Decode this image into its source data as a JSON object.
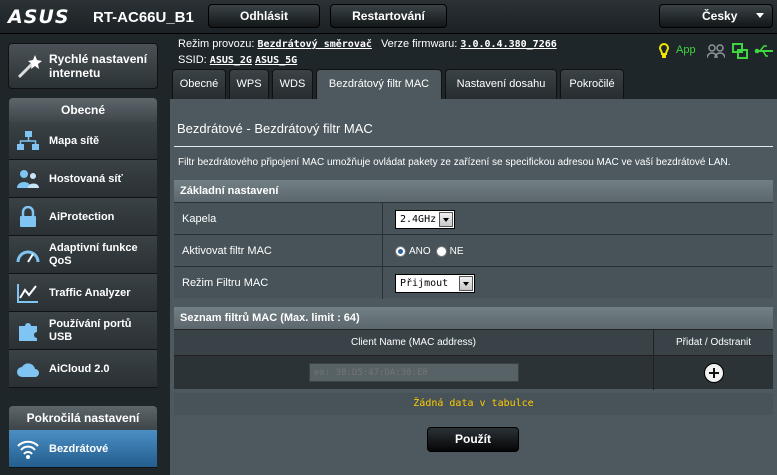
{
  "header": {
    "brand": "ASUS",
    "model": "RT-AC66U_B1",
    "logout_label": "Odhlásit",
    "restart_label": "Restartování",
    "language": "Česky"
  },
  "sidebar": {
    "quick_setup": "Rychlé nastavení internetu",
    "general_header": "Obecné",
    "general_items": [
      {
        "label": "Mapa sítě"
      },
      {
        "label": "Hostovaná síť"
      },
      {
        "label": "AiProtection"
      },
      {
        "label": "Adaptivní funkce QoS"
      },
      {
        "label": "Traffic Analyzer"
      },
      {
        "label": "Používání portů USB"
      },
      {
        "label": "AiCloud 2.0"
      }
    ],
    "advanced_header": "Pokročilá nastavení",
    "advanced_items": [
      {
        "label": "Bezdrátové"
      }
    ]
  },
  "info": {
    "mode_label": "Režim provozu:",
    "mode_value": "Bezdrátový směrovač",
    "firmware_label": "Verze firmwaru:",
    "firmware_value": "3.0.0.4.380_7266",
    "ssid_label": "SSID:",
    "ssid_2g": "ASUS_2G",
    "ssid_5g": "ASUS_5G",
    "app_label": "App"
  },
  "tabs": [
    {
      "label": "Obecné"
    },
    {
      "label": "WPS"
    },
    {
      "label": "WDS"
    },
    {
      "label": "Bezdrátový filtr MAC"
    },
    {
      "label": "Nastavení dosahu"
    },
    {
      "label": "Pokročilé"
    }
  ],
  "main": {
    "title": "Bezdrátové - Bezdrátový filtr MAC",
    "description": "Filtr bezdrátového připojení MAC umožňuje ovládat pakety ze zařízení se specifickou adresou MAC ve vaší bezdrátové LAN.",
    "basic": {
      "header": "Základní nastavení",
      "band_label": "Kapela",
      "band_value": "2.4GHz",
      "enable_label": "Aktivovat filtr MAC",
      "yes_label": "ANO",
      "no_label": "NE",
      "mode_label": "Režim Filtru MAC",
      "mode_value": "Přijmout"
    },
    "list": {
      "header": "Seznam filtrů MAC (Max. limit : 64)",
      "col_client": "Client Name (MAC address)",
      "col_action": "Přidat / Odstranit",
      "mac_placeholder": "ex: 38:D5:47:DA:30:E8",
      "empty_text": "Žádná data v tabulce"
    },
    "apply_label": "Použít"
  },
  "colors": {
    "panel": "#4d595e",
    "active_menu": "#3a7ab0",
    "status_green": "#3fd63f",
    "status_yellow": "#f2e600",
    "empty_text": "#ffcc00"
  }
}
